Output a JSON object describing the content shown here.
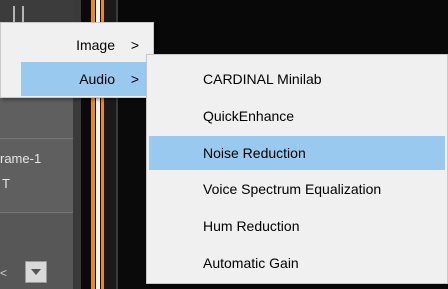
{
  "background": {
    "frame_label": "rame-1",
    "frame_sub": "T",
    "combo_stub": "<"
  },
  "menu": {
    "items": [
      {
        "label": "Image",
        "arrow": ">"
      },
      {
        "label": "Audio",
        "arrow": ">",
        "active": true
      }
    ]
  },
  "submenu": {
    "items": [
      {
        "label": "CARDINAL Minilab"
      },
      {
        "label": "QuickEnhance"
      },
      {
        "label": "Noise Reduction",
        "active": true
      },
      {
        "label": "Voice Spectrum Equalization"
      },
      {
        "label": "Hum Reduction"
      },
      {
        "label": "Automatic Gain"
      }
    ]
  },
  "colors": {
    "highlight": "#99c9ef",
    "menu_bg": "#f0f0f0",
    "accent_orange": "#ea8a22"
  }
}
